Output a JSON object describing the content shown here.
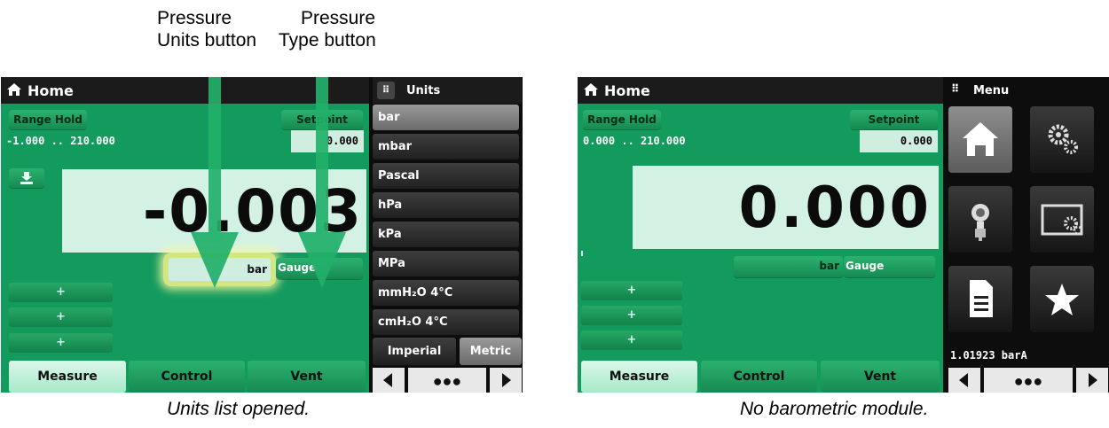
{
  "annotations": {
    "units_label_line1": "Pressure",
    "units_label_line2": "Units button",
    "type_label_line1": "Pressure",
    "type_label_line2": "Type button"
  },
  "left_screen": {
    "title": "Home",
    "range_hold_label": "Range Hold",
    "range_text": "-1.000 .. 210.000",
    "setpoint_label": "Setpoint",
    "setpoint_value": "0.000",
    "reading": "-0.003",
    "unit": "bar",
    "pressure_type": "Gauge",
    "plus_label": "+",
    "tabs": [
      "Measure",
      "Control",
      "Vent"
    ],
    "units_panel": {
      "title": "Units",
      "items": [
        "bar",
        "mbar",
        "Pascal",
        "hPa",
        "kPa",
        "MPa",
        "mmH₂O 4°C",
        "cmH₂O 4°C"
      ],
      "selected": "bar",
      "system_tabs": [
        "Imperial",
        "Metric"
      ],
      "active_system": "Metric"
    },
    "caption": "Units list opened."
  },
  "right_screen": {
    "title": "Home",
    "range_hold_label": "Range Hold",
    "range_text": "0.000 .. 210.000",
    "setpoint_label": "Setpoint",
    "setpoint_value": "0.000",
    "reading": "0.000",
    "unit": "bar",
    "pressure_type": "Gauge",
    "plus_label": "+",
    "tabs": [
      "Measure",
      "Control",
      "Vent"
    ],
    "menu_panel": {
      "title": "Menu",
      "tiles": [
        "home-icon",
        "settings-gears-icon",
        "sensor-icon",
        "display-settings-icon",
        "document-icon",
        "star-icon"
      ],
      "baro_reading": "1.01923 barA"
    },
    "caption": "No barometric module."
  },
  "colors": {
    "screen_green": "#139a5d",
    "reading_bg": "#d4f2e4",
    "arrow_green": "#1fa862",
    "highlight_yellow": "#f4f58a"
  }
}
